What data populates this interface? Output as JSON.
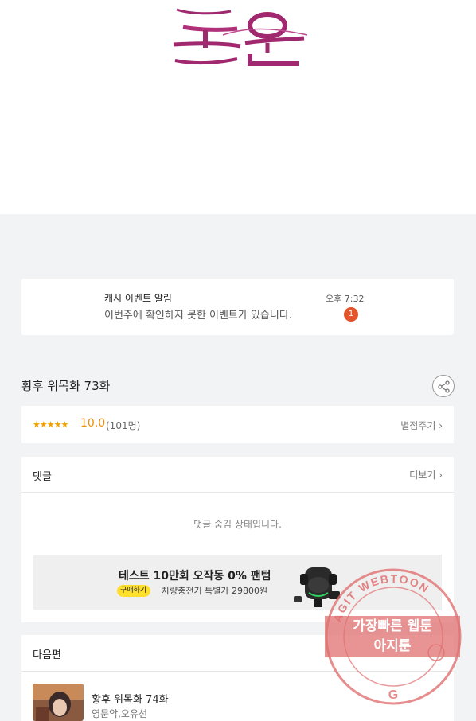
{
  "hero": {
    "logo_text": "누온"
  },
  "notice": {
    "title": "캐시 이벤트 알림",
    "message": "이번주에 확인하지 못한 이벤트가 있습니다.",
    "time": "오후 7:32",
    "badge_count": "1"
  },
  "episode": {
    "title": "황후 위목화 73화",
    "share_icon": "share-icon"
  },
  "rating": {
    "stars": "★★★★★",
    "score": "10.0",
    "count": "(101명)",
    "rate_link": "별점주기 ›"
  },
  "comments": {
    "title": "댓글",
    "more_link": "더보기 ›",
    "hidden_message": "댓글 숨김 상태입니다."
  },
  "ad": {
    "title": "테스트 10만회 오작동 0% 팬텀",
    "tag": "구매하기",
    "description": "차량충전기 특별가 29800원"
  },
  "next": {
    "section_title": "다음편",
    "title": "황후 위목화 74화",
    "author": "영문악,오유선"
  },
  "watermark": {
    "arc_text": "AGIT WEBTOON",
    "line1": "가장빠른 웹툰",
    "line2": "아지툰"
  },
  "colors": {
    "logo": "#a0286e",
    "accent": "#f08c00",
    "badge": "#e2542a",
    "stamp": "#e07070"
  }
}
